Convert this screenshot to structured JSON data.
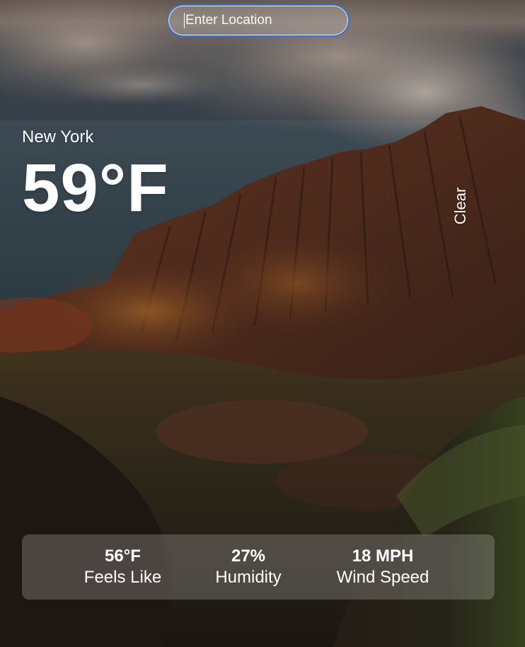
{
  "search": {
    "placeholder": "Enter Location",
    "value": ""
  },
  "weather": {
    "location": "New York",
    "temperature": "59°F",
    "condition": "Clear"
  },
  "stats": {
    "feels_like": {
      "value": "56°F",
      "label": "Feels Like"
    },
    "humidity": {
      "value": "27%",
      "label": "Humidity"
    },
    "wind_speed": {
      "value": "18 MPH",
      "label": "Wind Speed"
    }
  },
  "colors": {
    "search_border": "#3b6fd6",
    "text": "#ffffff"
  },
  "background": {
    "icon": "mountain-landscape-photo"
  }
}
